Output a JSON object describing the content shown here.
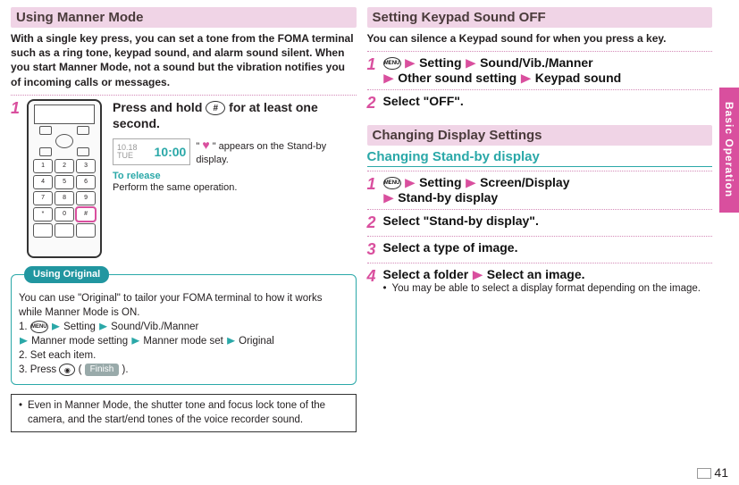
{
  "pageNumber": "41",
  "sideTab": "Basic Operation",
  "left": {
    "head": "Using Manner Mode",
    "intro": "With a single key press, you can set a tone from the FOMA terminal such as a ring tone, keypad sound, and alarm sound silent. When you start Manner Mode, not a sound but the vibration notifies you of incoming calls or messages.",
    "step1": {
      "num": "1",
      "title_before_icon": "Press and hold ",
      "title_after_icon": " for at least one second.",
      "standby_date_line1": "10.18",
      "standby_date_line2": "TUE",
      "standby_time": "10:00",
      "standby_note_before": "\" ",
      "standby_note_after": " \" appears on the Stand-by display.",
      "to_release_label": "To release",
      "to_release_text": "Perform the same operation."
    },
    "original": {
      "title": "Using Original",
      "lead": "You can use \"Original\" to tailor your FOMA terminal to how it works while Manner Mode is ON.",
      "o1_num": "1.",
      "o1_setting": "Setting",
      "o1_sound": "Sound/Vib./Manner",
      "o1_mode_setting": "Manner mode setting",
      "o1_mode_set": "Manner mode set",
      "o1_original": "Original",
      "o2": "2. Set each item.",
      "o3_before": "3. Press ",
      "o3_paren_open": "(",
      "o3_finish": "Finish",
      "o3_paren_close": ").",
      "menu_label": "MENU",
      "cam_glyph": "◉"
    },
    "note": "Even in Manner Mode, the shutter tone and focus lock tone of the camera, and the start/end tones of the voice recorder sound."
  },
  "right": {
    "keypad": {
      "head": "Setting Keypad Sound OFF",
      "intro": "You can silence a Keypad sound for when you press a key.",
      "s1_num": "1",
      "s1_menu": "MENU",
      "s1_setting": "Setting",
      "s1_sound": "Sound/Vib./Manner",
      "s1_other": "Other sound setting",
      "s1_keypad": "Keypad sound",
      "s2_num": "2",
      "s2_text": "Select \"OFF\"."
    },
    "display": {
      "head": "Changing Display Settings",
      "sub": "Changing Stand-by display",
      "s1_num": "1",
      "s1_menu": "MENU",
      "s1_setting": "Setting",
      "s1_screen": "Screen/Display",
      "s1_standby": "Stand-by display",
      "s2_num": "2",
      "s2_text": "Select \"Stand-by display\".",
      "s3_num": "3",
      "s3_text": "Select a type of image.",
      "s4_num": "4",
      "s4_before": "Select a folder",
      "s4_after": "Select an image.",
      "s4_note": "You may be able to select a display format depending on the image."
    }
  },
  "phone_keys": [
    "1",
    "2",
    "3",
    "4",
    "5",
    "6",
    "7",
    "8",
    "9",
    "*",
    "0",
    "#"
  ],
  "phone_row4_extra": [
    "",
    "",
    ""
  ],
  "hash_glyph": "#",
  "heart_glyph": "♥"
}
